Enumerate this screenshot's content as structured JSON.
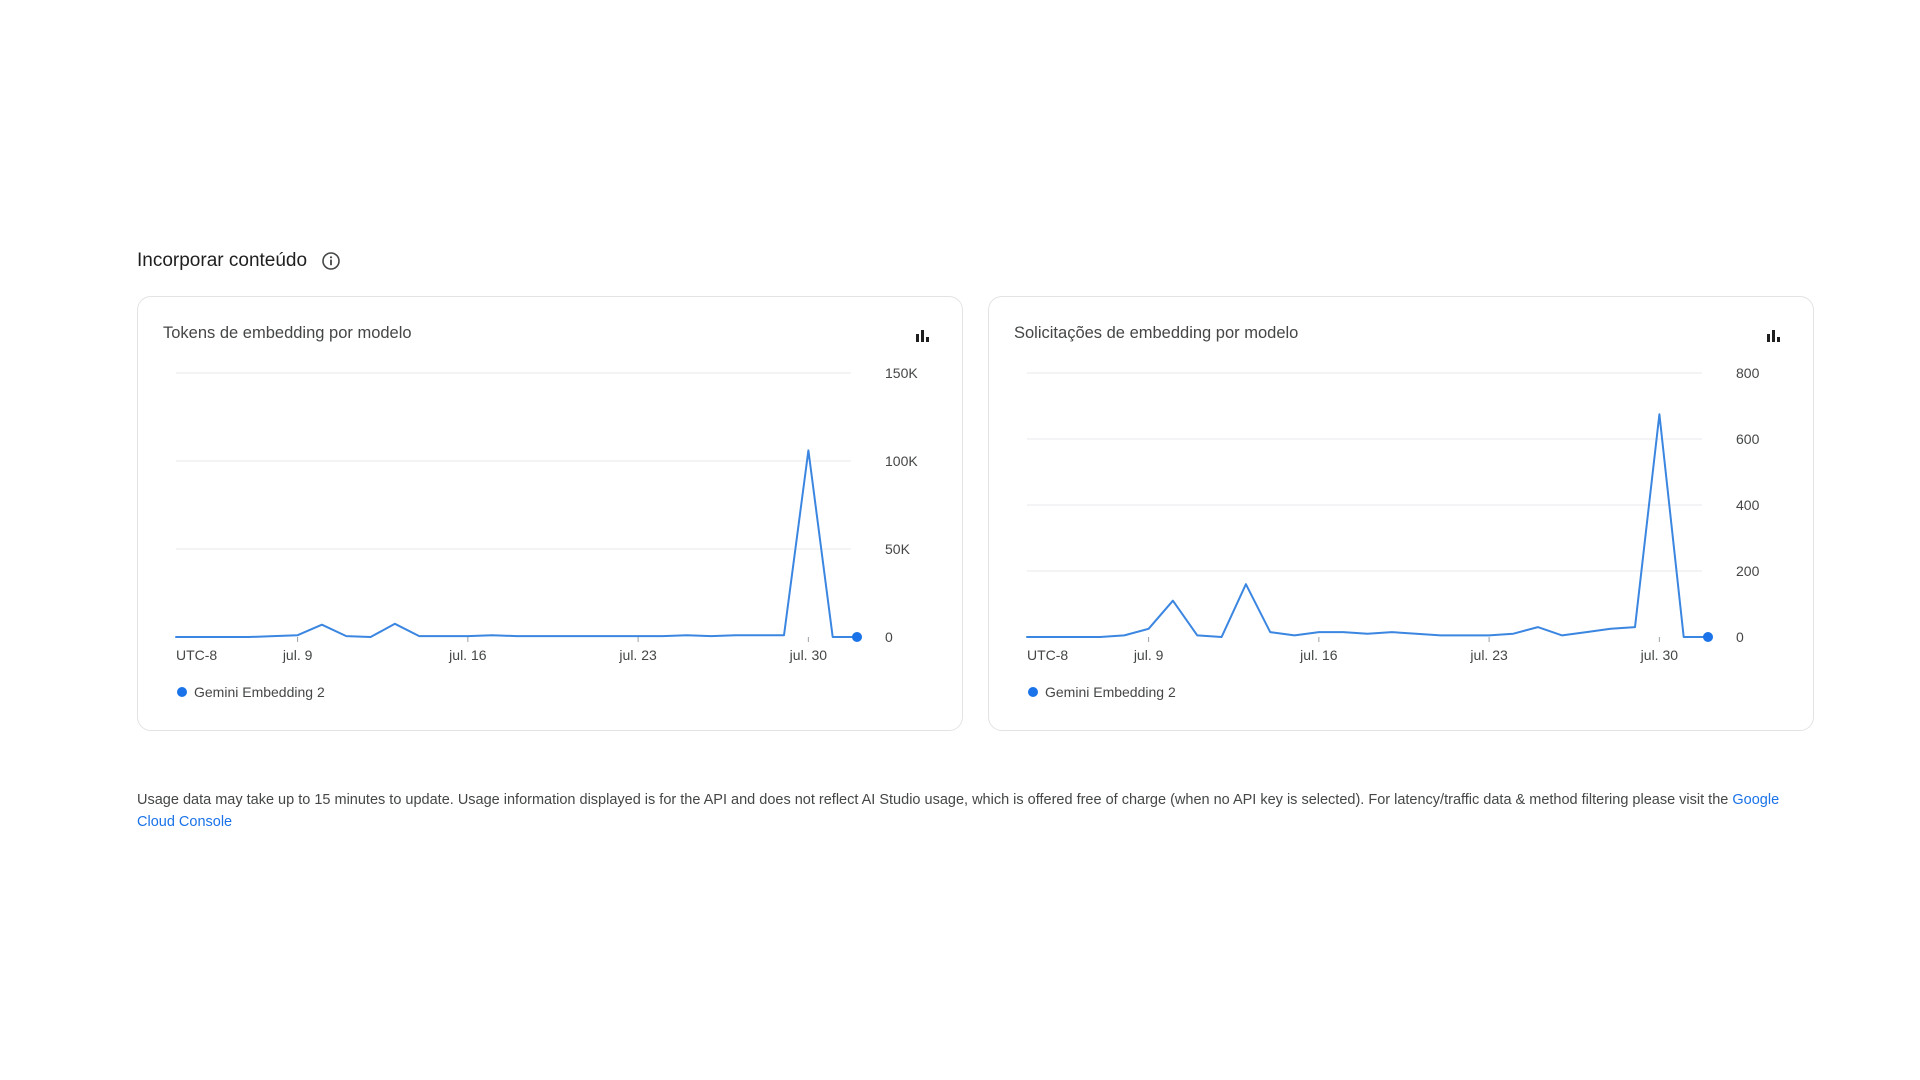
{
  "section": {
    "title": "Incorporar conteúdo",
    "info_icon": "info-circle-icon"
  },
  "colors": {
    "series": "#3b86e0",
    "grid": "#e8eaed",
    "link": "#1a73e8"
  },
  "charts": [
    {
      "title": "Tokens de embedding por modelo",
      "chart_type_icon": "bar-chart-icon",
      "timezone_label": "UTC-8",
      "legend": "Gemini Embedding 2"
    },
    {
      "title": "Solicitações de embedding por modelo",
      "chart_type_icon": "bar-chart-icon",
      "timezone_label": "UTC-8",
      "legend": "Gemini Embedding 2"
    }
  ],
  "chart_data": [
    {
      "type": "line",
      "title": "Tokens de embedding por modelo",
      "x_tick_labels": [
        "jul. 9",
        "jul. 16",
        "jul. 23",
        "jul. 30"
      ],
      "x": [
        "jul. 4",
        "jul. 5",
        "jul. 6",
        "jul. 7",
        "jul. 8",
        "jul. 9",
        "jul. 10",
        "jul. 11",
        "jul. 12",
        "jul. 13",
        "jul. 14",
        "jul. 15",
        "jul. 16",
        "jul. 17",
        "jul. 18",
        "jul. 19",
        "jul. 20",
        "jul. 21",
        "jul. 22",
        "jul. 23",
        "jul. 24",
        "jul. 25",
        "jul. 26",
        "jul. 27",
        "jul. 28",
        "jul. 29",
        "jul. 30",
        "jul. 31",
        "ago. 1"
      ],
      "y_tick_labels": [
        "0",
        "50K",
        "100K",
        "150K"
      ],
      "yticks": [
        0,
        50000,
        100000,
        150000
      ],
      "ylim": [
        0,
        150000
      ],
      "grid": true,
      "legend_position": "bottom-left",
      "series": [
        {
          "name": "Gemini Embedding 2",
          "values": [
            0,
            0,
            0,
            0,
            500,
            1000,
            7000,
            500,
            0,
            7500,
            500,
            500,
            500,
            1000,
            500,
            500,
            500,
            500,
            500,
            500,
            500,
            1000,
            500,
            1000,
            1000,
            1000,
            106000,
            0,
            0
          ]
        }
      ]
    },
    {
      "type": "line",
      "title": "Solicitações de embedding por modelo",
      "x_tick_labels": [
        "jul. 9",
        "jul. 16",
        "jul. 23",
        "jul. 30"
      ],
      "x": [
        "jul. 4",
        "jul. 5",
        "jul. 6",
        "jul. 7",
        "jul. 8",
        "jul. 9",
        "jul. 10",
        "jul. 11",
        "jul. 12",
        "jul. 13",
        "jul. 14",
        "jul. 15",
        "jul. 16",
        "jul. 17",
        "jul. 18",
        "jul. 19",
        "jul. 20",
        "jul. 21",
        "jul. 22",
        "jul. 23",
        "jul. 24",
        "jul. 25",
        "jul. 26",
        "jul. 27",
        "jul. 28",
        "jul. 29",
        "jul. 30",
        "jul. 31",
        "ago. 1"
      ],
      "y_tick_labels": [
        "0",
        "200",
        "400",
        "600",
        "800"
      ],
      "yticks": [
        0,
        200,
        400,
        600,
        800
      ],
      "ylim": [
        0,
        800
      ],
      "grid": true,
      "legend_position": "bottom-left",
      "series": [
        {
          "name": "Gemini Embedding 2",
          "values": [
            0,
            0,
            0,
            0,
            5,
            25,
            110,
            5,
            0,
            160,
            15,
            5,
            15,
            15,
            10,
            15,
            10,
            5,
            5,
            5,
            10,
            30,
            5,
            15,
            25,
            30,
            675,
            0,
            0
          ]
        }
      ]
    }
  ],
  "footer": {
    "text": "Usage data may take up to 15 minutes to update. Usage information displayed is for the API and does not reflect AI Studio usage, which is offered free of charge (when no API key is selected). For latency/traffic data & method filtering please visit the ",
    "link_label": "Google Cloud Console"
  }
}
